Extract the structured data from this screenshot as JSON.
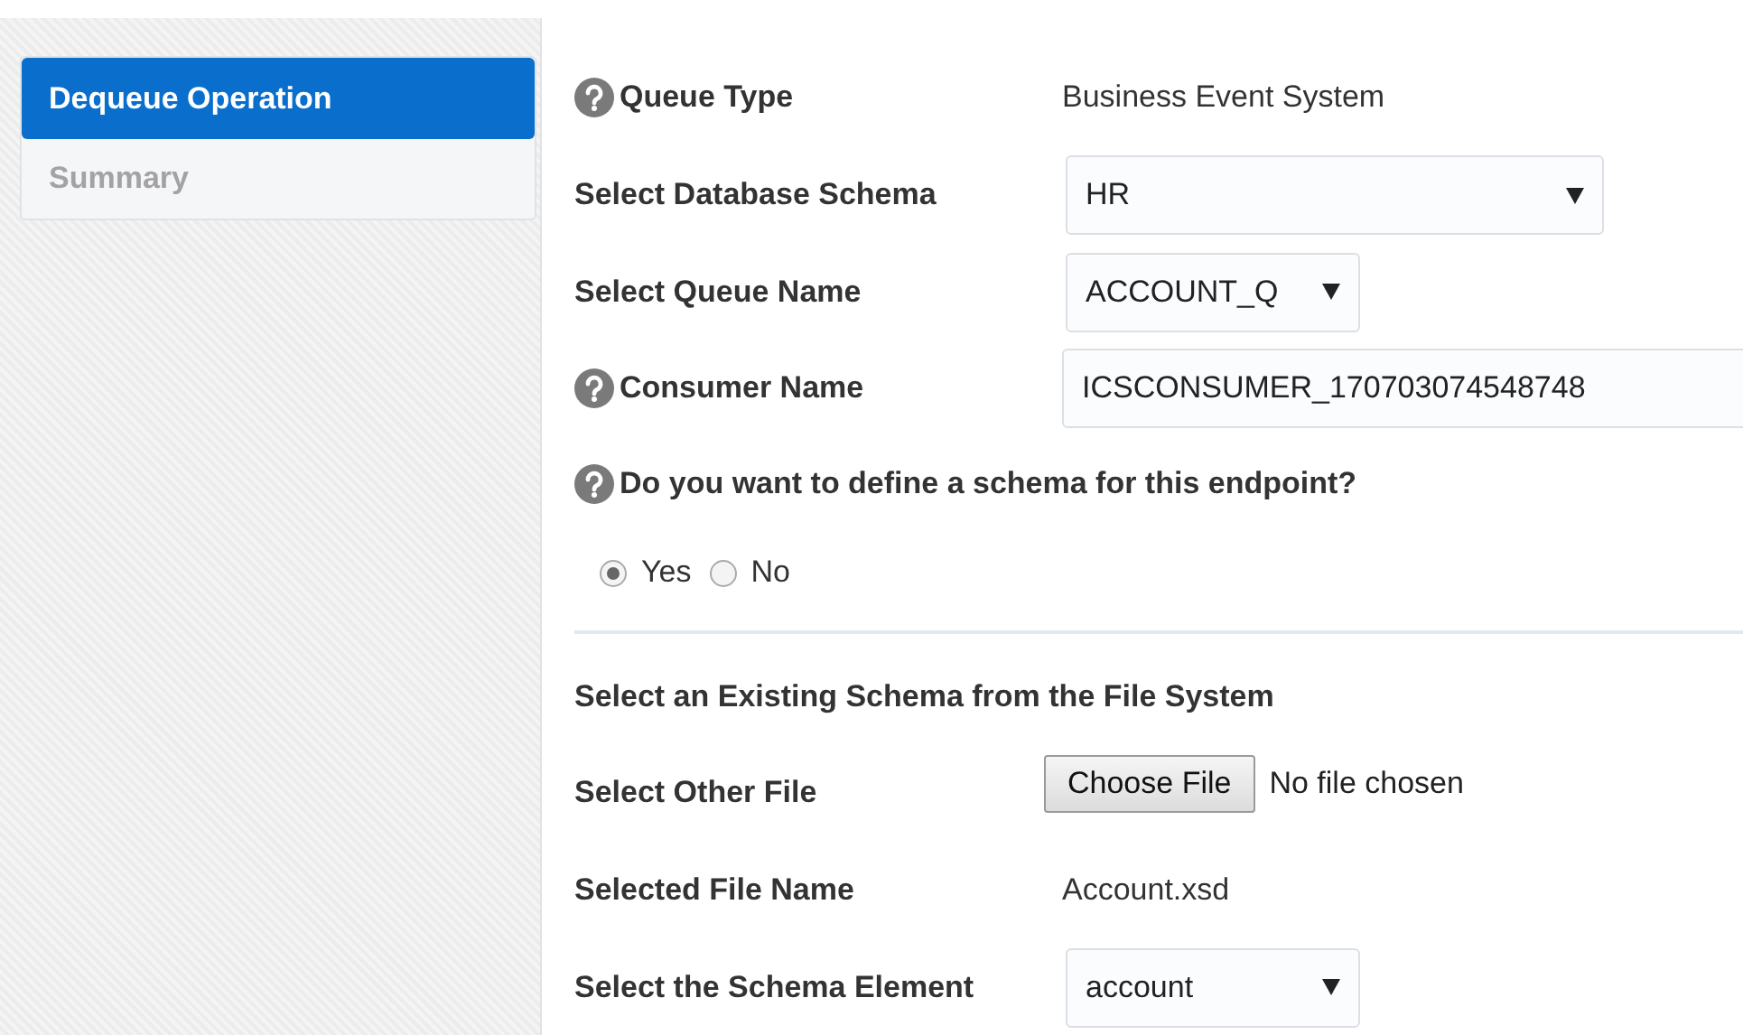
{
  "sidebar": {
    "items": [
      {
        "label": "Dequeue Operation",
        "selected": true
      },
      {
        "label": "Summary",
        "selected": false
      }
    ]
  },
  "form": {
    "rows": [
      {
        "kind": "text",
        "help": true,
        "label": "Queue Type",
        "value": "Business Event System"
      },
      {
        "kind": "wide-select",
        "help": false,
        "label": "Select Database Schema",
        "value": "HR"
      },
      {
        "kind": "select",
        "help": false,
        "label": "Select Queue Name",
        "value": "ACCOUNT_Q"
      },
      {
        "kind": "input",
        "help": true,
        "label": "Consumer Name",
        "value": "ICSCONSUMER_170703074548748"
      },
      {
        "kind": "question",
        "help": true,
        "label": "Do you want to define a schema for this endpoint?"
      },
      {
        "kind": "radio-group",
        "options": [
          {
            "label": "Yes",
            "selected": true
          },
          {
            "label": "No",
            "selected": false
          }
        ]
      },
      {
        "kind": "divider"
      },
      {
        "kind": "heading",
        "label": "Select an Existing Schema from the File System"
      },
      {
        "kind": "file",
        "help": false,
        "label": "Select Other File",
        "button": "Choose File",
        "status": "No file chosen"
      },
      {
        "kind": "text",
        "help": false,
        "label": "Selected File Name",
        "value": "Account.xsd"
      },
      {
        "kind": "select",
        "help": false,
        "label": "Select the Schema Element",
        "value": "account"
      }
    ]
  }
}
